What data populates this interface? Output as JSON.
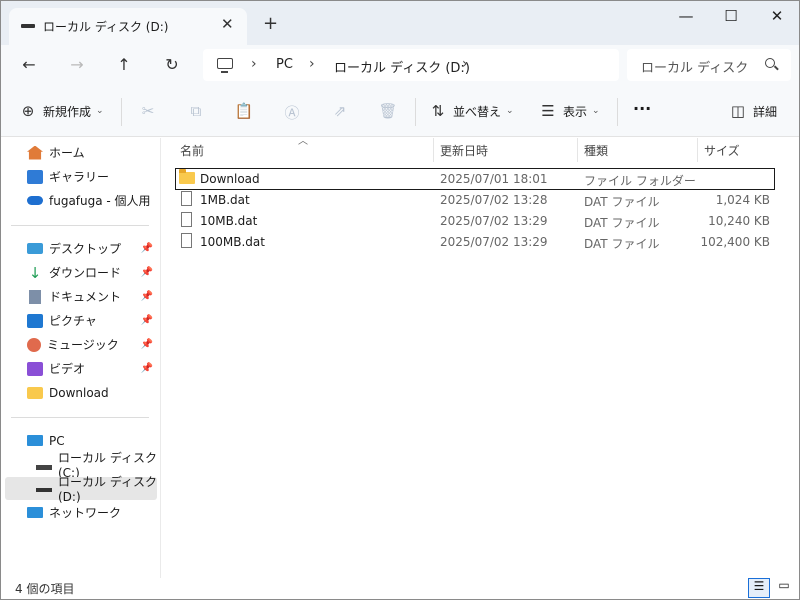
{
  "window": {
    "tab_title": "ローカル ディスク (D:)",
    "tab_close": "✕",
    "new_tab": "+",
    "minimize": "—",
    "maximize": "☐",
    "close": "✕"
  },
  "nav": {
    "back": "←",
    "forward": "→",
    "up": "↑",
    "refresh": "↻"
  },
  "address": {
    "crumbs": [
      "PC",
      "ローカル ディスク (D:)"
    ],
    "separator": "›"
  },
  "search": {
    "placeholder": "ローカル ディスク (D"
  },
  "commands": {
    "new_label": "新規作成",
    "sort_label": "並べ替え",
    "view_label": "表示",
    "more_label": "···",
    "details_label": "詳細"
  },
  "sidebar": {
    "quick": [
      {
        "label": "ホーム",
        "icon": "home-icon"
      },
      {
        "label": "ギャラリー",
        "icon": "gallery-icon"
      },
      {
        "label": "fugafuga - 個人用",
        "icon": "onedrive-icon"
      }
    ],
    "pinned": [
      {
        "label": "デスクトップ",
        "icon": "desktop-icon",
        "pinned": true
      },
      {
        "label": "ダウンロード",
        "icon": "downloads-icon",
        "pinned": true
      },
      {
        "label": "ドキュメント",
        "icon": "documents-icon",
        "pinned": true
      },
      {
        "label": "ピクチャ",
        "icon": "pictures-icon",
        "pinned": true
      },
      {
        "label": "ミュージック",
        "icon": "music-icon",
        "pinned": true
      },
      {
        "label": "ビデオ",
        "icon": "videos-icon",
        "pinned": true
      },
      {
        "label": "Download",
        "icon": "folder-icon",
        "pinned": false
      }
    ],
    "devices": [
      {
        "label": "PC",
        "icon": "pc-icon"
      },
      {
        "label": "ローカル ディスク (C:)",
        "icon": "drive-c-icon"
      },
      {
        "label": "ローカル ディスク (D:)",
        "icon": "drive-d-icon",
        "selected": true
      },
      {
        "label": "ネットワーク",
        "icon": "network-icon"
      }
    ]
  },
  "columns": {
    "name": "名前",
    "modified": "更新日時",
    "type": "種類",
    "size": "サイズ"
  },
  "files": [
    {
      "name": "Download",
      "modified": "2025/07/01 18:01",
      "type": "ファイル フォルダー",
      "size": "",
      "kind": "folder"
    },
    {
      "name": "1MB.dat",
      "modified": "2025/07/02 13:28",
      "type": "DAT ファイル",
      "size": "1,024 KB",
      "kind": "file"
    },
    {
      "name": "10MB.dat",
      "modified": "2025/07/02 13:29",
      "type": "DAT ファイル",
      "size": "10,240 KB",
      "kind": "file"
    },
    {
      "name": "100MB.dat",
      "modified": "2025/07/02 13:29",
      "type": "DAT ファイル",
      "size": "102,400 KB",
      "kind": "file"
    }
  ],
  "status": {
    "item_count": "4 個の項目"
  }
}
